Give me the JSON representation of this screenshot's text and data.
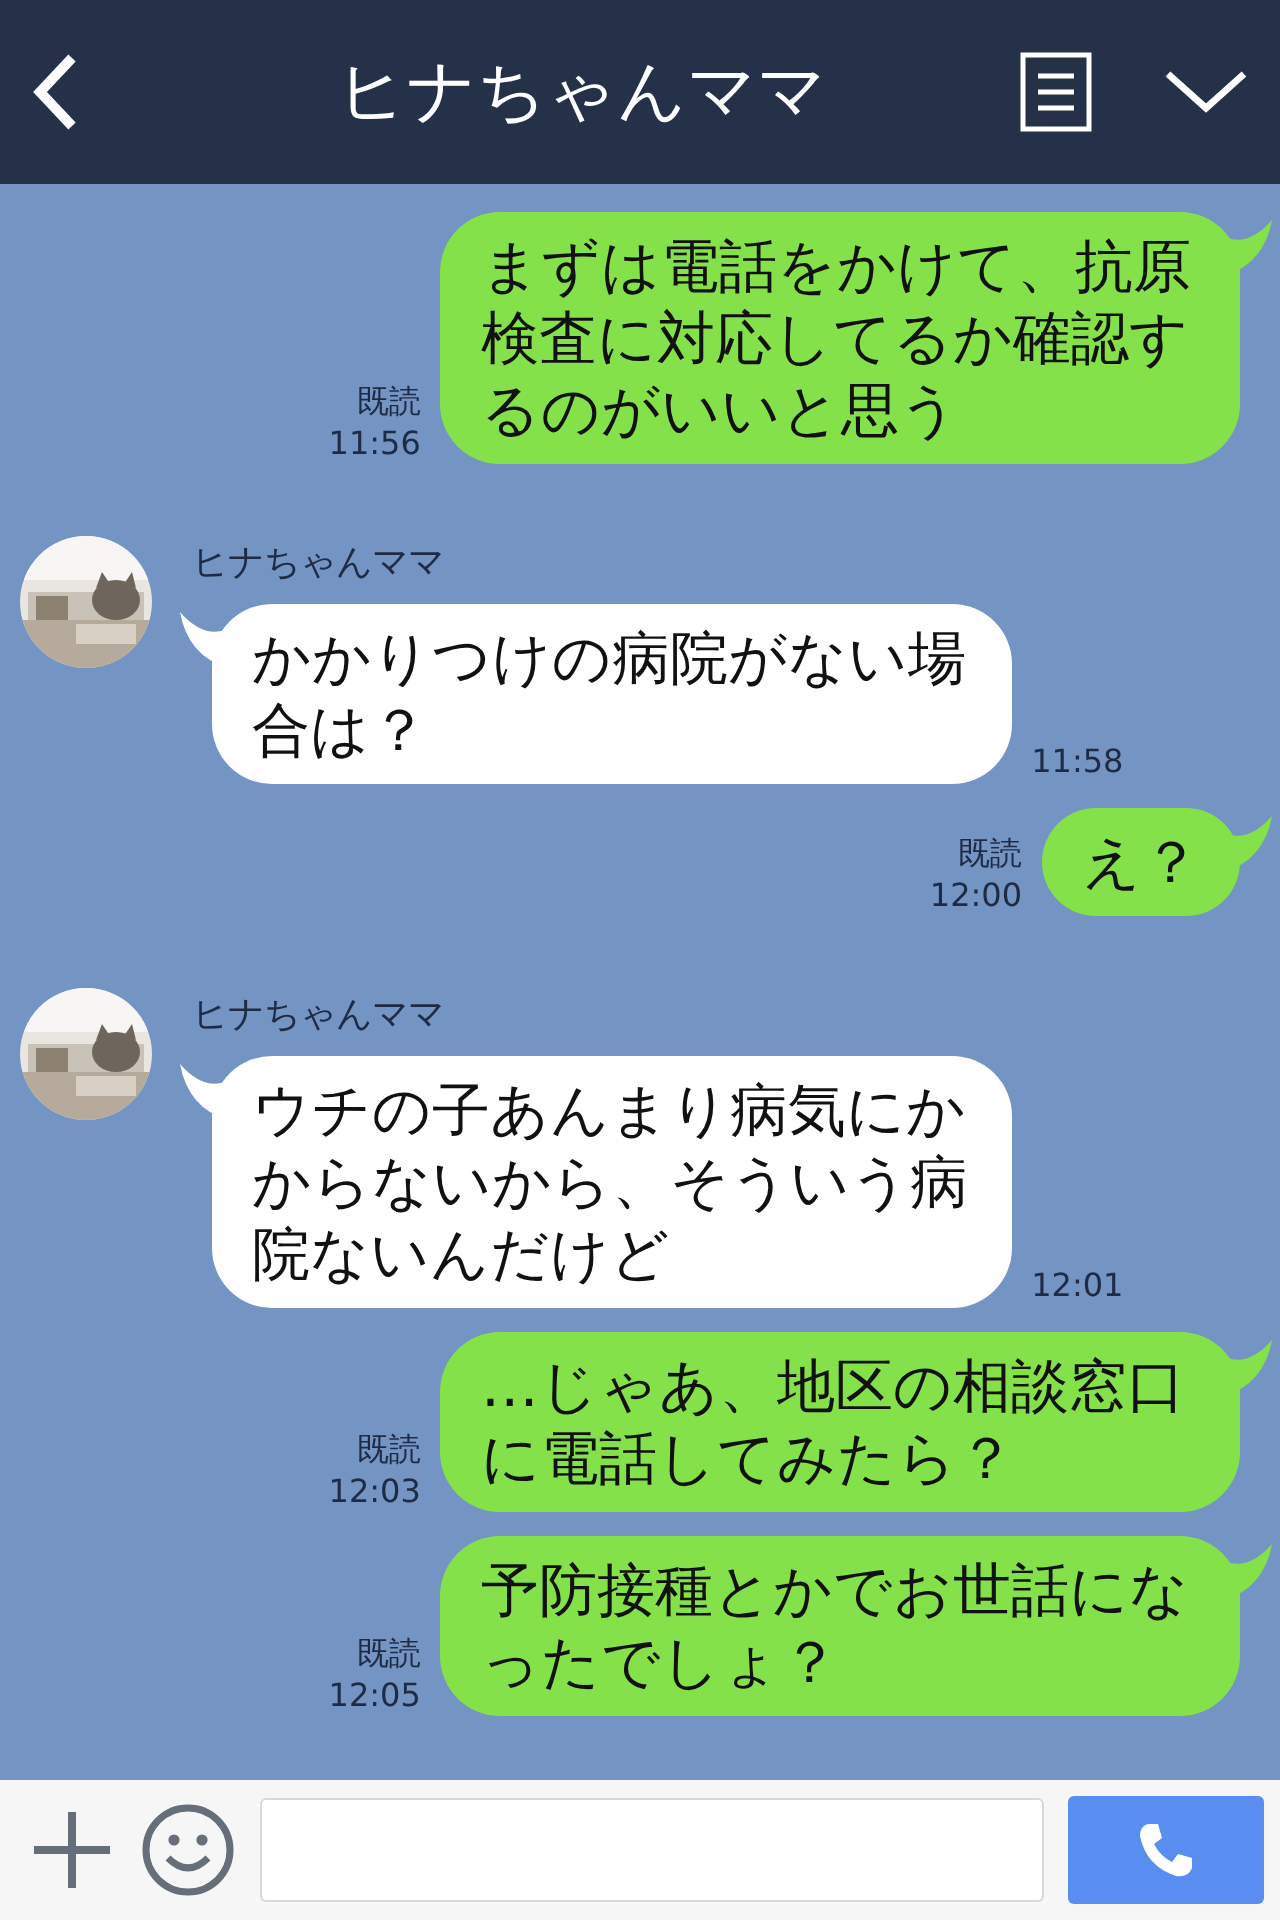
{
  "header": {
    "title": "ヒナちゃんママ"
  },
  "messages": [
    {
      "kind": "sent",
      "text": "まずは電話をかけて、抗原検査に対応してるか確認するのがいいと思う",
      "read_label": "既読",
      "time": "11:56"
    },
    {
      "kind": "received",
      "sender": "ヒナちゃんママ",
      "text": "かかりつけの病院がない場合は？",
      "time": "11:58"
    },
    {
      "kind": "sent",
      "text": "え？",
      "read_label": "既読",
      "time": "12:00"
    },
    {
      "kind": "received",
      "sender": "ヒナちゃんママ",
      "text": "ウチの子あんまり病気にかからないから、そういう病院ないんだけど",
      "time": "12:01"
    },
    {
      "kind": "sent",
      "text": "…じゃあ、地区の相談窓口に電話してみたら？",
      "read_label": "既読",
      "time": "12:03"
    },
    {
      "kind": "sent",
      "text": "予防接種とかでお世話になったでしょ？",
      "read_label": "既読",
      "time": "12:05"
    }
  ]
}
